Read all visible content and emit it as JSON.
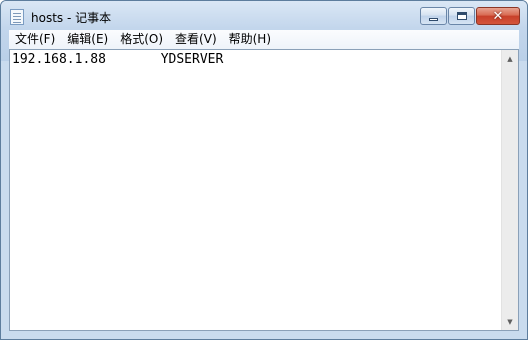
{
  "window": {
    "title": "hosts - 记事本"
  },
  "icons": {
    "app": "notepad-icon",
    "minimize": "minimize-icon",
    "maximize": "maximize-icon",
    "close": "close-icon",
    "scroll_up": "scroll-up-arrow-icon",
    "scroll_down": "scroll-down-arrow-icon"
  },
  "caption": {
    "close_glyph": "✕",
    "scroll_up_glyph": "▲",
    "scroll_down_glyph": "▼"
  },
  "menubar": {
    "items": [
      {
        "label": "文件(F)"
      },
      {
        "label": "编辑(E)"
      },
      {
        "label": "格式(O)"
      },
      {
        "label": "查看(V)"
      },
      {
        "label": "帮助(H)"
      }
    ]
  },
  "editor": {
    "content": "192.168.1.88       YDSERVER"
  },
  "colors": {
    "frame": "#c9dbee",
    "close_button": "#c7402a"
  }
}
